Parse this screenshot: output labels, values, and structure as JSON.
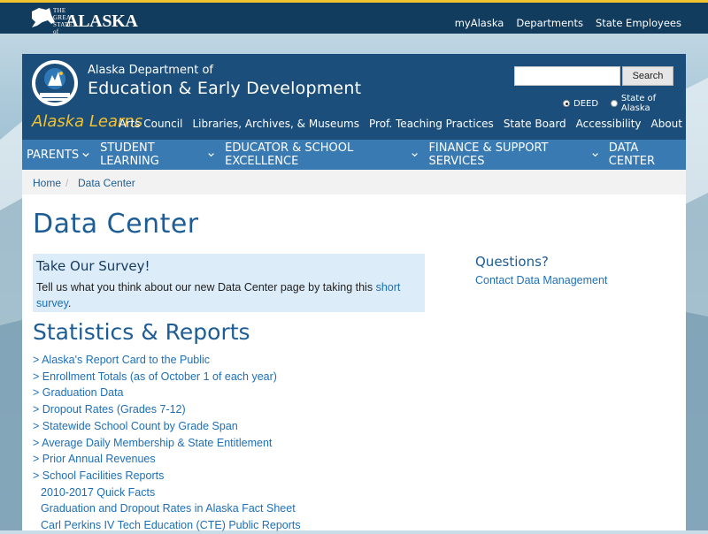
{
  "topbar": {
    "logo_pre": "THE GREAT STATE of",
    "logo_name": "ALASKA",
    "links": [
      "myAlaska",
      "Departments",
      "State Employees"
    ]
  },
  "header": {
    "dept_small": "Alaska Department of",
    "dept_big": "Education & Early Development",
    "search_button": "Search",
    "search_value": "",
    "radios": [
      {
        "label": "DEED",
        "selected": true
      },
      {
        "label": "State of Alaska",
        "selected": false
      }
    ],
    "tagline": "Alaska Learns",
    "sublinks": [
      "Arts Council",
      "Libraries, Archives, & Museums",
      "Prof. Teaching Practices",
      "State Board",
      "Accessibility",
      "About"
    ]
  },
  "mainnav": [
    {
      "label": "PARENTS",
      "icon": "chevron-down-icon"
    },
    {
      "label": "STUDENT LEARNING",
      "icon": "chevron-down-icon"
    },
    {
      "label": "EDUCATOR & SCHOOL EXCELLENCE",
      "icon": "chevron-down-icon"
    },
    {
      "label": "FINANCE & SUPPORT SERVICES",
      "icon": "chevron-down-icon"
    },
    {
      "label": "DATA CENTER",
      "icon": ""
    }
  ],
  "breadcrumb": [
    "Home",
    "/",
    "Data Center"
  ],
  "page_title": "Data Center",
  "survey": {
    "heading": "Take Our Survey!",
    "text": "Tell us what you think about our new Data Center page by taking this ",
    "link": "short survey",
    "end": "."
  },
  "sidebar": {
    "heading": "Questions?",
    "contact": "Contact Data Management"
  },
  "stats": {
    "heading": "Statistics & Reports",
    "links": [
      "> Alaska's Report Card to the Public",
      "> Enrollment Totals (as of October 1 of each year)",
      "> Graduation Data",
      "> Dropout Rates (Grades 7-12)",
      "> Statewide School Count by Grade Span",
      "> Average Daily Membership & State Entitlement",
      "> Prior Annual Revenues",
      "> School Facilities Reports"
    ],
    "sublinks": [
      "2010-2017 Quick Facts",
      "Graduation and Dropout Rates in Alaska Fact Sheet",
      "Carl Perkins IV Tech Education (CTE) Public Reports"
    ]
  },
  "colors": {
    "topbar": "#123c5e",
    "header": "#1b4e7a",
    "nav": "#3a7ab2",
    "accent_gold": "#f2c230",
    "link": "#1d6fb8",
    "heading": "#1d5d96"
  }
}
